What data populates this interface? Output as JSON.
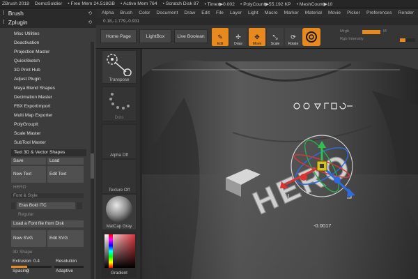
{
  "titlebar": {
    "app": "ZBrush 2018",
    "project": "DemoSoldier",
    "free_mem": "• Free Mem 24.518GB",
    "active_mem": "• Active Mem 764",
    "scratch": "• Scratch Disk 87",
    "timer": "• Timer▶0.002",
    "polycount": "• PolyCount▶55.192 KP",
    "meshcount": "• MeshCount▶10"
  },
  "panels": {
    "brush": "Brush",
    "zplugin": "Zplugin",
    "pin": "⟲"
  },
  "menubar": [
    "Alpha",
    "Brush",
    "Color",
    "Document",
    "Draw",
    "Edit",
    "File",
    "Layer",
    "Light",
    "Macro",
    "Marker",
    "Material",
    "Movie",
    "Picker",
    "Preferences",
    "Render"
  ],
  "coords": "0.18,-1.779,-0.931",
  "toolbar": {
    "home_page": "Home Page",
    "lightbox": "LightBox",
    "live_boolean": "Live Boolean",
    "edit": "Edit",
    "draw": "Draw",
    "move": "Move",
    "scale": "Scale",
    "rotate": "Rotate",
    "mrgb": "Mrgb",
    "rgb_intensity": "Rgb Intensity",
    "m": "M",
    "rgb_intensity_value": 0.35
  },
  "plugins": [
    "Misc Utilities",
    "Deactivation",
    "Projection Master",
    "QuickSketch",
    "3D Print Hub",
    "Adjust Plugin",
    "Maya Blend Shapes",
    "Decimation Master",
    "FBX ExportImport",
    "Multi Map Exporter",
    "PolyGroupIt",
    "Scale Master",
    "SubTool Master"
  ],
  "text3d": {
    "header": "Text 3D & Vector Shapes",
    "save": "Save",
    "load": "Load",
    "new_text": "New Text",
    "edit_text": "Edit Text",
    "hero": "HERO",
    "font_style": "Font & Style",
    "font_name": "Eras Bold ITC",
    "regular": "Regular",
    "load_font": "Load a Font file from Disk",
    "new_svg": "New SVG",
    "edit_svg": "Edit SVG",
    "shape_3d": "3D Shape",
    "extrusion_label": "Extrusion",
    "extrusion_value": "0.4",
    "extrusion_fraction": 0.4,
    "resolution": "Resolution",
    "spacing_label": "Spacing",
    "spacing_value": "0",
    "adaptive": "Adaptive"
  },
  "shelf": {
    "transpose": "Transpose",
    "dots": "Dots",
    "alpha_off": "Alpha Off",
    "texture_off": "Texture Off",
    "matcap": "MatCap Gray",
    "gradient": "Gradient"
  },
  "viewport": {
    "model_text": "HERO",
    "readout": "-0.0017"
  },
  "colors": {
    "accent": "#e8891f",
    "panel": "#3c3c3c",
    "viewport": "#3d3d3d"
  }
}
